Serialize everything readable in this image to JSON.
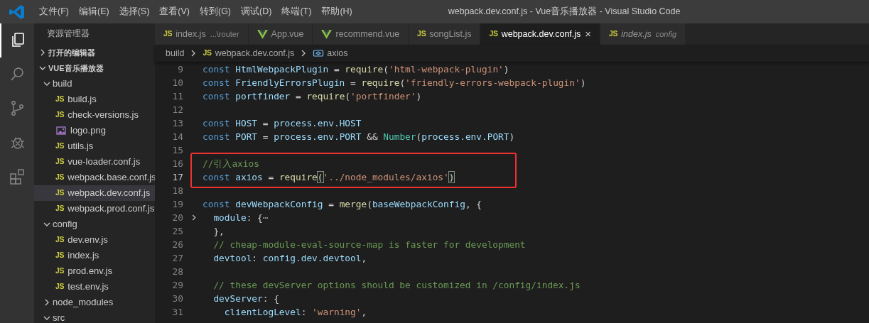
{
  "window": {
    "title": "webpack.dev.conf.js - Vue音乐播放器 - Visual Studio Code"
  },
  "menu": [
    "文件(F)",
    "编辑(E)",
    "选择(S)",
    "查看(V)",
    "转到(G)",
    "调试(D)",
    "终端(T)",
    "帮助(H)"
  ],
  "activity_bar": [
    {
      "kind": "explorer",
      "selected": true
    },
    {
      "kind": "search",
      "selected": false
    },
    {
      "kind": "source-control",
      "selected": false
    },
    {
      "kind": "debug",
      "selected": false
    },
    {
      "kind": "extensions",
      "selected": false
    }
  ],
  "sidebar": {
    "title": "资源管理器",
    "sections": [
      {
        "label": "打开的编辑器",
        "expanded": false
      },
      {
        "label": "VUE音乐播放器",
        "expanded": true,
        "items": [
          {
            "label": "build",
            "kind": "folder",
            "expanded": true,
            "selected": false,
            "children": [
              {
                "label": "build.js",
                "kind": "js",
                "badge": "JS",
                "selected": false
              },
              {
                "label": "check-versions.js",
                "kind": "js",
                "badge": "JS",
                "selected": false
              },
              {
                "label": "logo.png",
                "kind": "image",
                "selected": false
              },
              {
                "label": "utils.js",
                "kind": "js",
                "badge": "JS",
                "selected": false
              },
              {
                "label": "vue-loader.conf.js",
                "kind": "js",
                "badge": "JS",
                "selected": false
              },
              {
                "label": "webpack.base.conf.js",
                "kind": "js",
                "badge": "JS",
                "selected": false
              },
              {
                "label": "webpack.dev.conf.js",
                "kind": "js",
                "badge": "JS",
                "selected": true
              },
              {
                "label": "webpack.prod.conf.js",
                "kind": "js",
                "badge": "JS",
                "selected": false
              }
            ]
          },
          {
            "label": "config",
            "kind": "folder",
            "expanded": true,
            "selected": false,
            "children": [
              {
                "label": "dev.env.js",
                "kind": "js",
                "badge": "JS",
                "selected": false
              },
              {
                "label": "index.js",
                "kind": "js",
                "badge": "JS",
                "selected": false
              },
              {
                "label": "prod.env.js",
                "kind": "js",
                "badge": "JS",
                "selected": false
              },
              {
                "label": "test.env.js",
                "kind": "js",
                "badge": "JS",
                "selected": false
              }
            ]
          },
          {
            "label": "node_modules",
            "kind": "folder",
            "expanded": false,
            "selected": false
          },
          {
            "label": "src",
            "kind": "folder",
            "expanded": true,
            "selected": false
          }
        ]
      }
    ]
  },
  "tabs": [
    {
      "label": "index.js",
      "kind": "js",
      "badge": "JS",
      "description": "...\\router",
      "selected": false,
      "preview": false
    },
    {
      "label": "App.vue",
      "kind": "vue",
      "selected": false,
      "preview": false
    },
    {
      "label": "recommend.vue",
      "kind": "vue",
      "selected": false,
      "preview": false
    },
    {
      "label": "songList.js",
      "kind": "js",
      "badge": "JS",
      "selected": false,
      "preview": false
    },
    {
      "label": "webpack.dev.conf.js",
      "kind": "js",
      "badge": "JS",
      "selected": true,
      "preview": false,
      "close": "×"
    },
    {
      "label": "index.js",
      "kind": "js",
      "badge": "JS",
      "description": "config",
      "selected": false,
      "preview": true
    }
  ],
  "breadcrumb": [
    {
      "kind": "folder",
      "label": "build"
    },
    {
      "kind": "js",
      "badge": "JS",
      "label": "webpack.dev.conf.js"
    },
    {
      "kind": "symbol",
      "label": "axios"
    }
  ],
  "code": {
    "lines": [
      {
        "number": "9",
        "current": false,
        "tokens": [
          {
            "kind": "keyword",
            "text": "const "
          },
          {
            "kind": "variable",
            "text": "HtmlWebpackPlugin"
          },
          {
            "kind": "plain",
            "text": " = "
          },
          {
            "kind": "function",
            "text": "require"
          },
          {
            "kind": "plain",
            "text": "("
          },
          {
            "kind": "string",
            "text": "'html-webpack-plugin'"
          },
          {
            "kind": "plain",
            "text": ")"
          }
        ]
      },
      {
        "number": "10",
        "current": false,
        "tokens": [
          {
            "kind": "keyword",
            "text": "const "
          },
          {
            "kind": "variable",
            "text": "FriendlyErrorsPlugin"
          },
          {
            "kind": "plain",
            "text": " = "
          },
          {
            "kind": "function",
            "text": "require"
          },
          {
            "kind": "plain",
            "text": "("
          },
          {
            "kind": "string",
            "text": "'friendly-errors-webpack-plugin'"
          },
          {
            "kind": "plain",
            "text": ")"
          }
        ]
      },
      {
        "number": "11",
        "current": false,
        "tokens": [
          {
            "kind": "keyword",
            "text": "const "
          },
          {
            "kind": "variable",
            "text": "portfinder"
          },
          {
            "kind": "plain",
            "text": " = "
          },
          {
            "kind": "function",
            "text": "require"
          },
          {
            "kind": "plain",
            "text": "("
          },
          {
            "kind": "string",
            "text": "'portfinder'"
          },
          {
            "kind": "plain",
            "text": ")"
          }
        ]
      },
      {
        "number": "12",
        "current": false
      },
      {
        "number": "13",
        "current": false,
        "tokens": [
          {
            "kind": "keyword",
            "text": "const "
          },
          {
            "kind": "variable",
            "text": "HOST"
          },
          {
            "kind": "plain",
            "text": " = "
          },
          {
            "kind": "variable",
            "text": "process.env.HOST"
          }
        ]
      },
      {
        "number": "14",
        "current": false,
        "tokens": [
          {
            "kind": "keyword",
            "text": "const "
          },
          {
            "kind": "variable",
            "text": "PORT"
          },
          {
            "kind": "plain",
            "text": " = "
          },
          {
            "kind": "variable",
            "text": "process.env.PORT"
          },
          {
            "kind": "plain",
            "text": " && "
          },
          {
            "kind": "type",
            "text": "Number"
          },
          {
            "kind": "plain",
            "text": "("
          },
          {
            "kind": "variable",
            "text": "process.env.PORT"
          },
          {
            "kind": "plain",
            "text": ")"
          }
        ]
      },
      {
        "number": "15",
        "current": false
      },
      {
        "number": "16",
        "current": false,
        "boxed": true,
        "tokens": [
          {
            "kind": "comment",
            "text": "//引入axios"
          }
        ]
      },
      {
        "number": "17",
        "current": true,
        "boxed": true,
        "tokens": [
          {
            "kind": "keyword",
            "text": "const "
          },
          {
            "kind": "variable",
            "text": "axios"
          },
          {
            "kind": "plain",
            "text": " = "
          },
          {
            "kind": "function",
            "text": "require"
          },
          {
            "kind": "bracket-match",
            "text": "("
          },
          {
            "kind": "string",
            "text": "'../node_modules/axios'"
          },
          {
            "kind": "bracket-match",
            "text": ")"
          }
        ]
      },
      {
        "number": "18",
        "current": false
      },
      {
        "number": "19",
        "current": false,
        "tokens": [
          {
            "kind": "keyword",
            "text": "const "
          },
          {
            "kind": "variable",
            "text": "devWebpackConfig"
          },
          {
            "kind": "plain",
            "text": " = "
          },
          {
            "kind": "function",
            "text": "merge"
          },
          {
            "kind": "plain",
            "text": "("
          },
          {
            "kind": "variable",
            "text": "baseWebpackConfig"
          },
          {
            "kind": "plain",
            "text": ", {"
          }
        ]
      },
      {
        "number": "20",
        "current": false,
        "folded": true,
        "tokens": [
          {
            "kind": "variable",
            "text": "  module"
          },
          {
            "kind": "plain",
            "text": ": {"
          },
          {
            "kind": "ellipsis",
            "text": "⋯"
          }
        ]
      },
      {
        "number": "25",
        "current": false,
        "tokens": [
          {
            "kind": "plain",
            "text": "  },"
          }
        ]
      },
      {
        "number": "26",
        "current": false,
        "tokens": [
          {
            "kind": "comment",
            "text": "  // cheap-module-eval-source-map is faster for development"
          }
        ]
      },
      {
        "number": "27",
        "current": false,
        "tokens": [
          {
            "kind": "variable",
            "text": "  devtool"
          },
          {
            "kind": "plain",
            "text": ": "
          },
          {
            "kind": "variable",
            "text": "config.dev.devtool"
          },
          {
            "kind": "plain",
            "text": ","
          }
        ]
      },
      {
        "number": "28",
        "current": false
      },
      {
        "number": "29",
        "current": false,
        "tokens": [
          {
            "kind": "comment",
            "text": "  // these devServer options should be customized in /config/index.js"
          }
        ]
      },
      {
        "number": "30",
        "current": false,
        "tokens": [
          {
            "kind": "variable",
            "text": "  devServer"
          },
          {
            "kind": "plain",
            "text": ": {"
          }
        ]
      },
      {
        "number": "31",
        "current": false,
        "tokens": [
          {
            "kind": "variable",
            "text": "    clientLogLevel"
          },
          {
            "kind": "plain",
            "text": ": "
          },
          {
            "kind": "string",
            "text": "'warning'"
          },
          {
            "kind": "plain",
            "text": ","
          }
        ]
      }
    ]
  }
}
